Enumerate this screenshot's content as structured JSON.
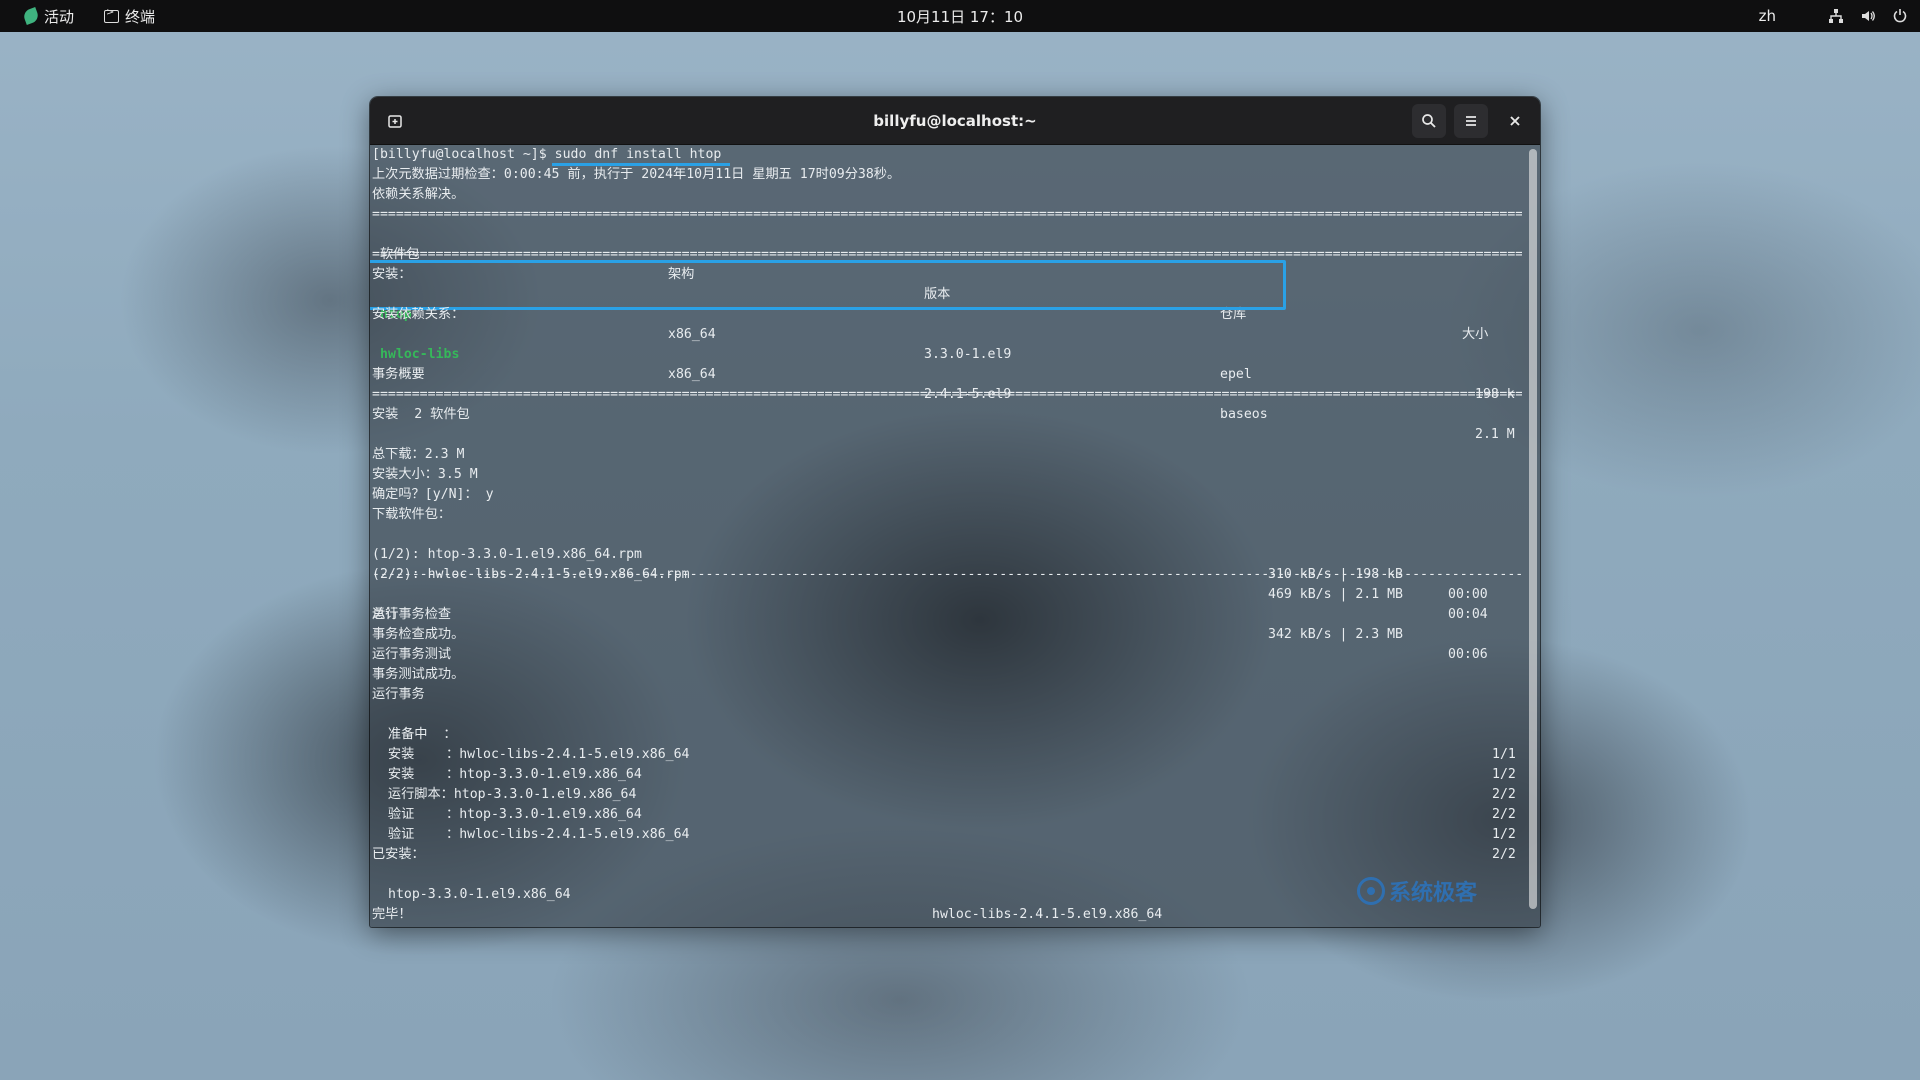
{
  "topbar": {
    "activities_label": "活动",
    "app_label": "终端",
    "clock": "10月11日 17：10",
    "language": "zh"
  },
  "window": {
    "title": "billyfu@localhost:~"
  },
  "terminal": {
    "prompt": "[billyfu@localhost ~]$ ",
    "command": "sudo dnf install htop",
    "metadata_line": "上次元数据过期检查：0:00:45 前，执行于 2024年10月11日 星期五 17时09分38秒。",
    "deps_resolved": "依赖关系解决。",
    "separator": "================================================================================================================================================================",
    "dash_separator": "----------------------------------------------------------------------------------------------------------------------------------------------------------------",
    "table_headers": {
      "package": "软件包",
      "arch": "架构",
      "version": "版本",
      "repo": "仓库",
      "size": "大小"
    },
    "install_label": "安装：",
    "dep_install_label": "安装依赖关系：",
    "rows": [
      {
        "name": "htop",
        "arch": "x86_64",
        "version": "3.3.0-1.el9",
        "repo": "epel",
        "size": "198 k"
      },
      {
        "name": "hwloc-libs",
        "arch": "x86_64",
        "version": "2.4.1-5.el9",
        "repo": "baseos",
        "size": "2.1 M"
      }
    ],
    "summary_title": "事务概要",
    "install_count": "安装  2 软件包",
    "total_download": "总下载：2.3 M",
    "install_size": "安装大小：3.5 M",
    "confirm": "确定吗？[y/N]： y",
    "downloading": "下载软件包：",
    "downloads": [
      {
        "file": "(1/2): htop-3.3.0-1.el9.x86_64.rpm",
        "rate": "310 kB/s | 198 kB",
        "time": "00:00"
      },
      {
        "file": "(2/2): hwloc-libs-2.4.1-5.el9.x86_64.rpm",
        "rate": "469 kB/s | 2.1 MB",
        "time": "00:04"
      }
    ],
    "total": {
      "label": "总计",
      "rate": "342 kB/s | 2.3 MB",
      "time": "00:06"
    },
    "tx_lines": [
      "运行事务检查",
      "事务检查成功。",
      "运行事务测试",
      "事务测试成功。",
      "运行事务"
    ],
    "steps": [
      {
        "text": "  准备中  ：",
        "count": "1/1"
      },
      {
        "text": "  安装    ：hwloc-libs-2.4.1-5.el9.x86_64",
        "count": "1/2"
      },
      {
        "text": "  安装    ：htop-3.3.0-1.el9.x86_64",
        "count": "2/2"
      },
      {
        "text": "  运行脚本：htop-3.3.0-1.el9.x86_64",
        "count": "2/2"
      },
      {
        "text": "  验证    ：htop-3.3.0-1.el9.x86_64",
        "count": "1/2"
      },
      {
        "text": "  验证    ：hwloc-libs-2.4.1-5.el9.x86_64",
        "count": "2/2"
      }
    ],
    "installed_label": "已安装：",
    "installed": [
      "htop-3.3.0-1.el9.x86_64",
      "hwloc-libs-2.4.1-5.el9.x86_64"
    ],
    "complete": "完毕！"
  },
  "watermark": "系统极客",
  "colors": {
    "accent_highlight": "#2aa1e6",
    "package_green": "#36b85a",
    "watermark_blue": "#2f6fb0"
  },
  "icons": [
    "activities-logo-icon",
    "terminal-icon",
    "network-icon",
    "volume-icon",
    "power-icon",
    "new-tab-icon",
    "search-icon",
    "menu-icon",
    "close-icon"
  ]
}
